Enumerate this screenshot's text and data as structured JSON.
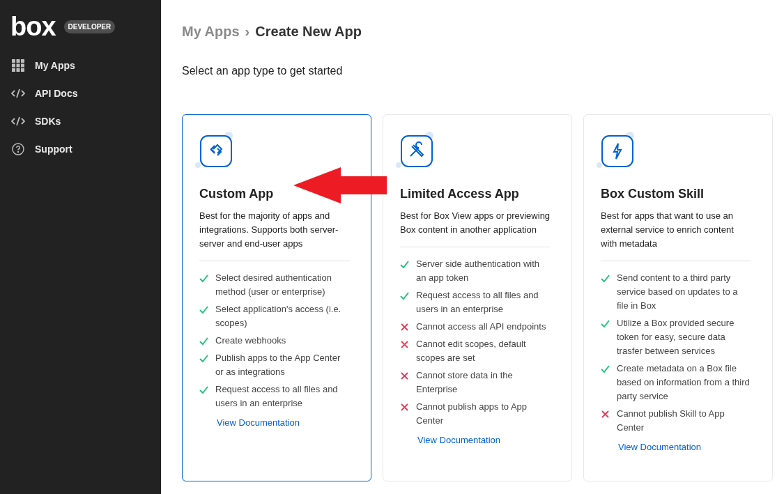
{
  "sidebar": {
    "logo": "box",
    "badge": "DEVELOPER",
    "items": [
      {
        "label": "My Apps",
        "kind": "grid"
      },
      {
        "label": "API Docs",
        "kind": "code"
      },
      {
        "label": "SDKs",
        "kind": "code"
      },
      {
        "label": "Support",
        "kind": "help"
      }
    ]
  },
  "breadcrumb": {
    "parent": "My Apps",
    "separator": "›",
    "current": "Create New App"
  },
  "subtitle": "Select an app type to get started",
  "cards": [
    {
      "kind": "link",
      "title": "Custom App",
      "selected": true,
      "description": "Best for the majority of apps and integrations. Supports both server-server and end-user apps",
      "features": [
        {
          "kind": "check",
          "text": "Select desired authentication method (user or enterprise)"
        },
        {
          "kind": "check",
          "text": "Select application's access (i.e. scopes)"
        },
        {
          "kind": "check",
          "text": "Create webhooks"
        },
        {
          "kind": "check",
          "text": "Publish apps to the App Center or as integrations"
        },
        {
          "kind": "check",
          "text": "Request access to all files and users in an enterprise"
        }
      ],
      "link": "View Documentation"
    },
    {
      "kind": "tools",
      "title": "Limited Access App",
      "selected": false,
      "description": "Best for Box View apps or previewing Box content in another application",
      "features": [
        {
          "kind": "check",
          "text": "Server side authentication with an app token"
        },
        {
          "kind": "check",
          "text": "Request access to all files and users in an enterprise"
        },
        {
          "kind": "cross",
          "text": "Cannot access all API endpoints"
        },
        {
          "kind": "cross",
          "text": "Cannot edit scopes, default scopes are set"
        },
        {
          "kind": "cross",
          "text": "Cannot store data in the Enterprise"
        },
        {
          "kind": "cross",
          "text": "Cannot publish apps to App Center"
        }
      ],
      "link": "View Documentation"
    },
    {
      "kind": "bolt",
      "title": "Box Custom Skill",
      "selected": false,
      "description": "Best for apps that want to use an external service to enrich content with metadata",
      "features": [
        {
          "kind": "check",
          "text": "Send content to a third party service based on updates to a file in Box"
        },
        {
          "kind": "check",
          "text": "Utilize a Box provided secure token for easy, secure data trasfer between services"
        },
        {
          "kind": "check",
          "text": "Create metadata on a Box file based on information from a third party service"
        },
        {
          "kind": "cross",
          "text": "Cannot publish Skill to App Center"
        }
      ],
      "link": "View Documentation"
    }
  ]
}
